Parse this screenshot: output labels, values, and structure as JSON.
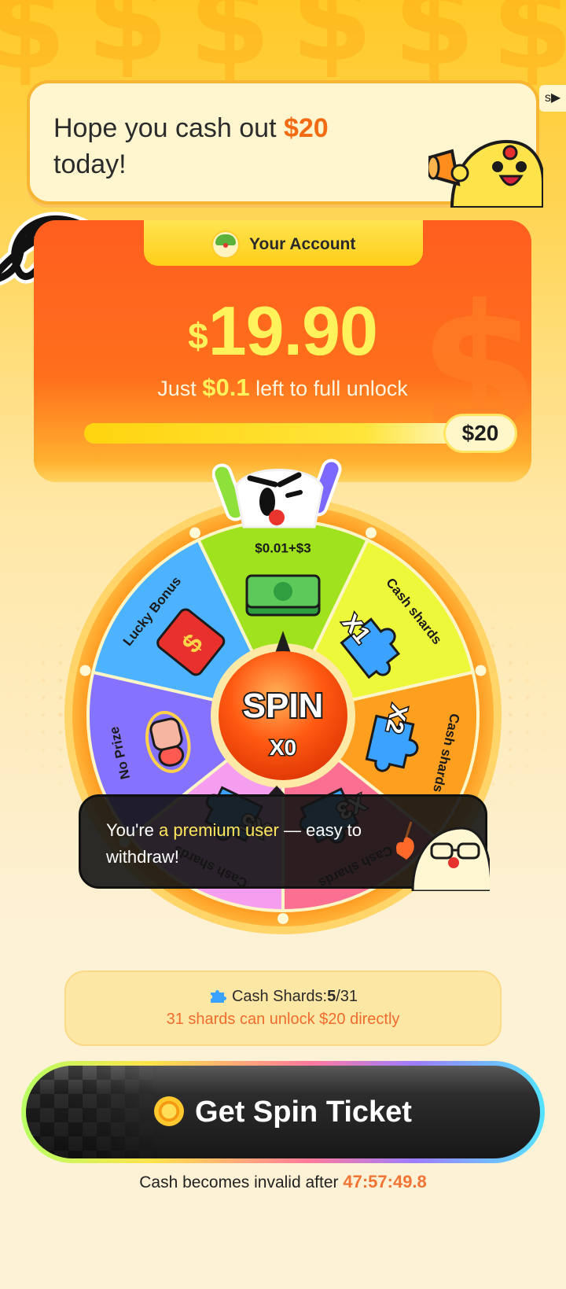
{
  "header": {
    "message_prefix": "Hope you cash out",
    "message_amount": "$20",
    "message_suffix": "today!",
    "skip_label": "s▶"
  },
  "account": {
    "tab_label": "Your Account",
    "currency_symbol": "$",
    "balance": "19.90",
    "unlock_prefix": "Just",
    "unlock_amount": "$0.1",
    "unlock_suffix": "left to full unlock",
    "progress_percent": 99.5,
    "goal_label": "$20"
  },
  "wheel": {
    "segments": [
      {
        "label": "$0.01+$3",
        "color": "#9fe21d",
        "icon": "cash-stack-icon"
      },
      {
        "label": "Cash shards",
        "multiplier": "X1",
        "color": "#eef83a",
        "icon": "puzzle-piece-icon"
      },
      {
        "label": "Cash shards",
        "multiplier": "X2",
        "color": "#ff9f1f",
        "icon": "puzzle-piece-icon"
      },
      {
        "label": "Cash shards",
        "multiplier": "X3",
        "color": "#fb6f92",
        "icon": "puzzle-piece-icon"
      },
      {
        "label": "Cash shards",
        "multiplier": "X5",
        "color": "#f59ef0",
        "icon": "puzzle-piece-icon"
      },
      {
        "label": "No Prize",
        "color": "#8572ff",
        "icon": "empty-hands-icon"
      },
      {
        "label": "Lucky Bonus",
        "color": "#4db2ff",
        "icon": "red-envelope-icon"
      }
    ],
    "spin_label": "SPIN",
    "spin_count": "X0",
    "rim_color": "#ff9a15"
  },
  "tooltip": {
    "prefix": "You're",
    "highlight": "a premium user",
    "suffix": "— easy to withdraw!"
  },
  "shards": {
    "label": "Cash Shards:",
    "current": "5",
    "total": "/31",
    "hint": "31 shards can unlock $20 directly"
  },
  "cta": {
    "button_label": "Get Spin Ticket",
    "expire_prefix": "Cash becomes invalid after",
    "timer": "47:57:49.8"
  }
}
